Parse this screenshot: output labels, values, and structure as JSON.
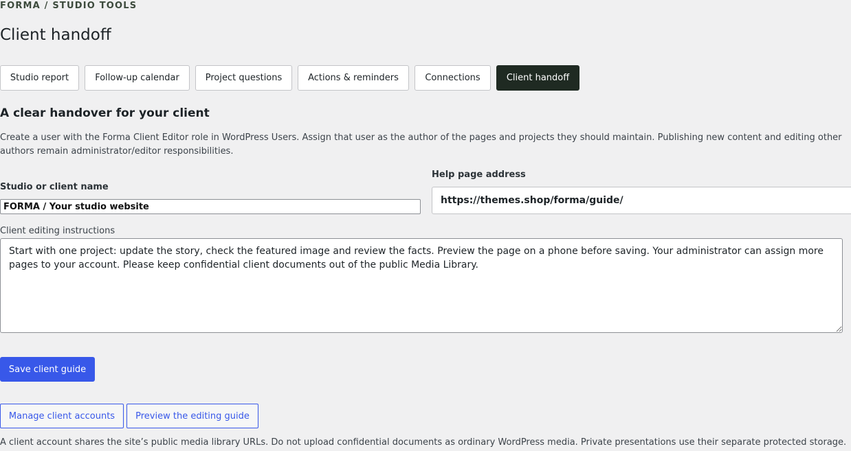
{
  "header": {
    "eyebrow": "FORMA / STUDIO TOOLS",
    "title": "Client handoff"
  },
  "tabs": [
    {
      "label": "Studio report",
      "active": false
    },
    {
      "label": "Follow-up calendar",
      "active": false
    },
    {
      "label": "Project questions",
      "active": false
    },
    {
      "label": "Actions & reminders",
      "active": false
    },
    {
      "label": "Connections",
      "active": false
    },
    {
      "label": "Client handoff",
      "active": true
    }
  ],
  "section": {
    "title": "A clear handover for your client",
    "intro": "Create a user with the Forma Client Editor role in WordPress Users. Assign that user as the author of the pages and projects they should maintain. Publishing new content and editing other authors remain administrator/editor responsibilities."
  },
  "form": {
    "name_label": "Studio or client name",
    "name_value": "FORMA / Your studio website",
    "help_label": "Help page address",
    "help_value": "https://themes.shop/forma/guide/",
    "instructions_label": "Client editing instructions",
    "instructions_value": "Start with one project: update the story, check the featured image and review the facts. Preview the page on a phone before saving. Your administrator can assign more pages to your account. Please keep confidential client documents out of the public Media Library."
  },
  "buttons": {
    "save": "Save client guide",
    "manage": "Manage client accounts",
    "preview": "Preview the editing guide"
  },
  "footnote": "A client account shares the site’s public media library URLs. Do not upload confidential documents as ordinary WordPress media. Private presentations use their separate protected storage.",
  "colors": {
    "accent": "#3858e9",
    "active_tab": "#1f2a22",
    "background": "#f0f0f1"
  }
}
